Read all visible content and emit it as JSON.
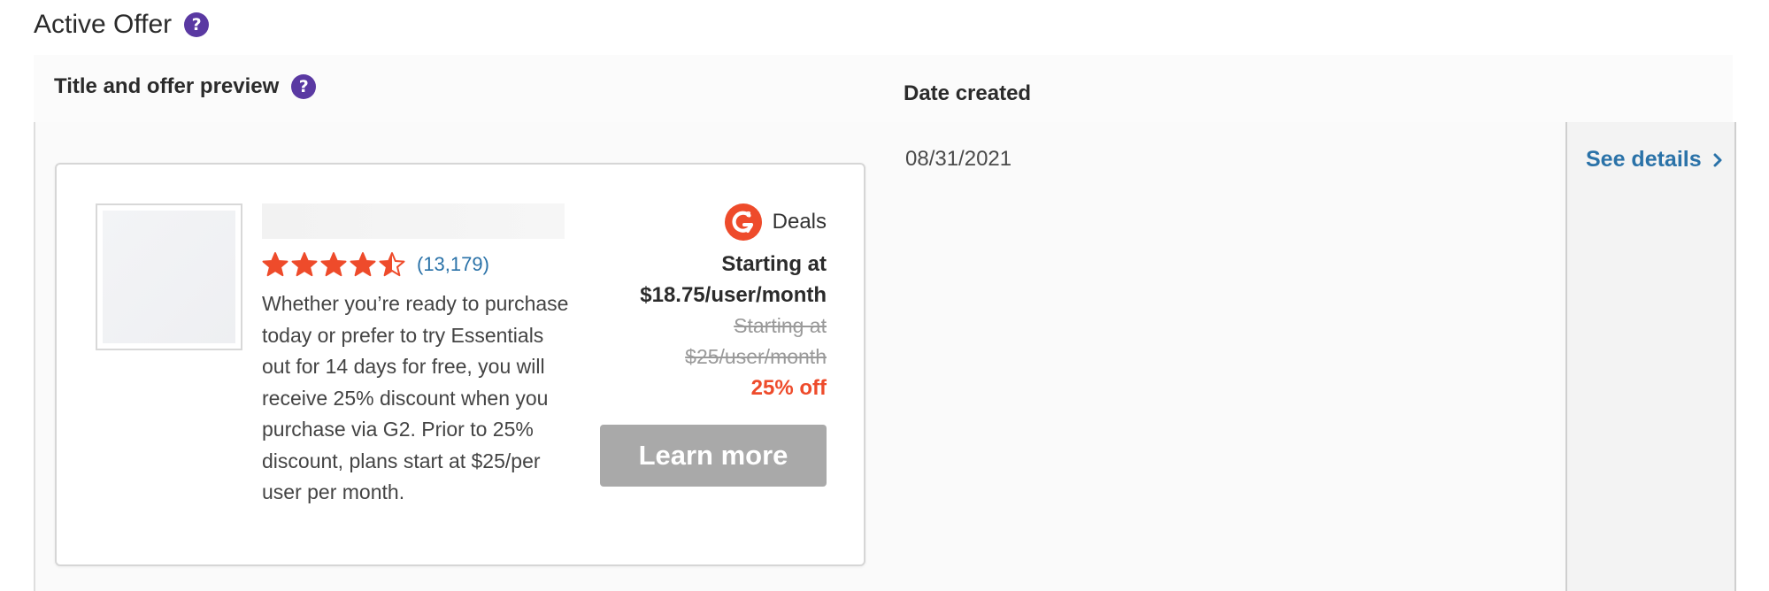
{
  "section": {
    "title": "Active Offer",
    "help_glyph": "?"
  },
  "table": {
    "headers": {
      "title_preview": "Title and offer preview",
      "date_created": "Date created"
    },
    "row": {
      "date_created": "08/31/2021",
      "see_details": "See details"
    }
  },
  "offer": {
    "rating": {
      "stars": 4.5,
      "max": 5,
      "review_count": "(13,179)",
      "star_color": "#ee4b2b"
    },
    "description": "Whether you’re ready to purchase today or prefer to try Essentials out for 14 days for free, you will receive 25% discount when you purchase via G2. Prior to 25% discount, plans start at $25/per user per month.",
    "brand": {
      "logo_icon": "g2-logo-icon",
      "label": "Deals",
      "color": "#ee4b2b"
    },
    "price": {
      "current_line1": "Starting at",
      "current_line2": "$18.75/user/month",
      "original_line1": "Starting at",
      "original_line2": "$25/user/month",
      "discount": "25% off"
    },
    "cta_label": "Learn more"
  },
  "colors": {
    "accent_purple": "#5a39a2",
    "link_blue": "#2a72a8",
    "discount_red": "#ee4b2b",
    "cta_disabled_gray": "#a9a9a9"
  }
}
